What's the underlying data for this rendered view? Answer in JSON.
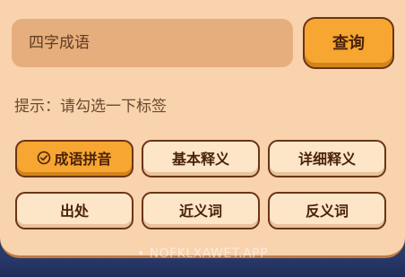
{
  "search": {
    "placeholder": "四字成语"
  },
  "query_button": {
    "label": "查询"
  },
  "hint": "提示：请勾选一下标签",
  "options": [
    {
      "label": "成语拼音",
      "selected": true
    },
    {
      "label": "基本释义",
      "selected": false
    },
    {
      "label": "详细释义",
      "selected": false
    },
    {
      "label": "出处",
      "selected": false
    },
    {
      "label": "近义词",
      "selected": false
    },
    {
      "label": "反义词",
      "selected": false
    }
  ],
  "watermark": "• NOFKLXAWET.APP",
  "colors": {
    "panel": "#f8d3ae",
    "accent": "#f6a631",
    "border": "#6b3416",
    "input": "#e6ae7d"
  }
}
